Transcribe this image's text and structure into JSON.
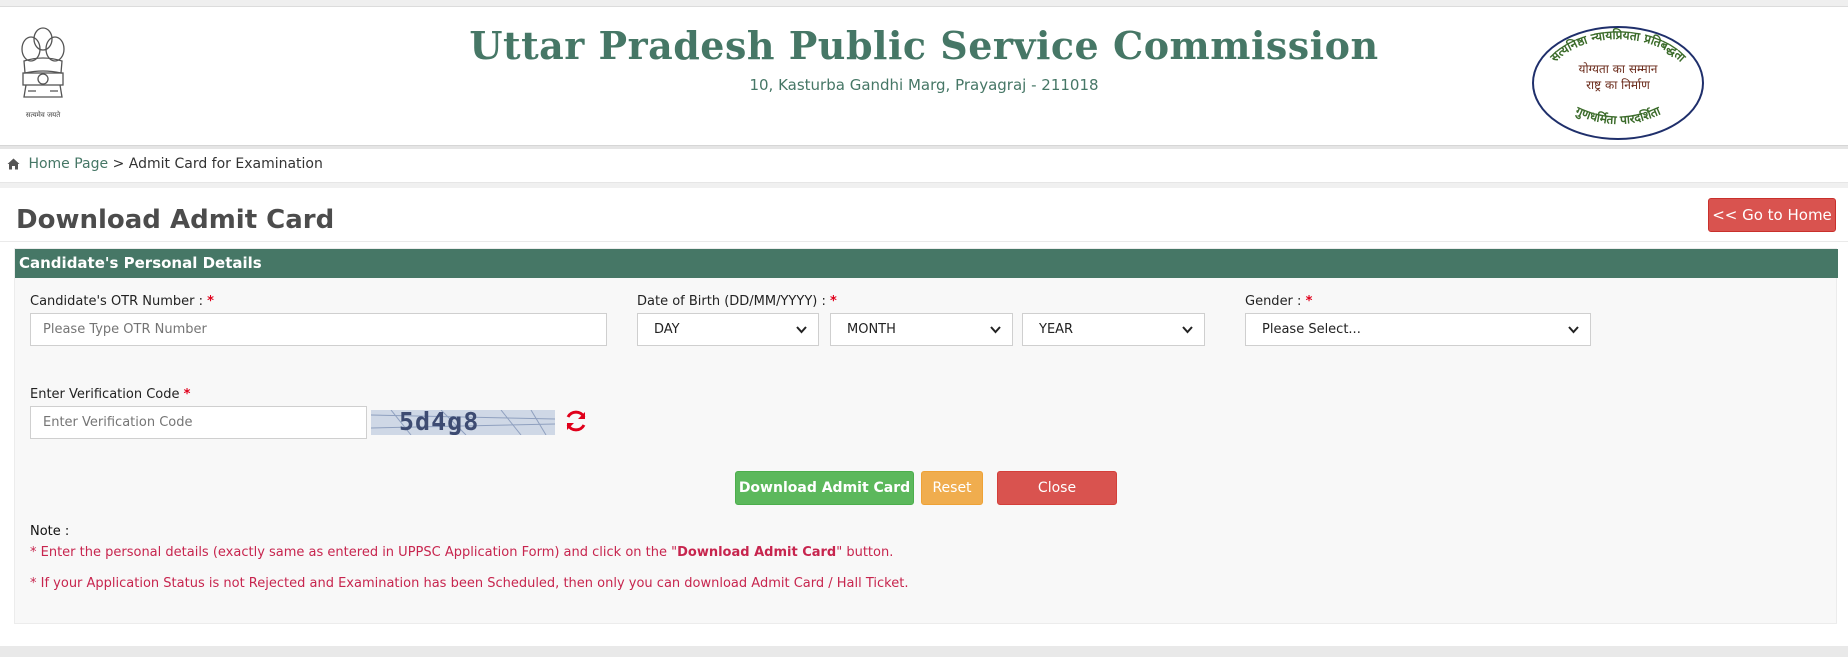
{
  "header": {
    "title": "Uttar Pradesh Public Service Commission",
    "address": "10, Kasturba Gandhi Marg, Prayagraj - 211018",
    "emblem_caption": "सत्यमेव जयते",
    "seal_text_top": "सत्यनिष्ठा न्यायप्रियता प्रतिबद्धता",
    "seal_line1": "योग्यता का सम्मान",
    "seal_line2": "राष्ट्र का निर्माण",
    "seal_text_bottom": "गुणधर्मिता पारदर्शिता"
  },
  "breadcrumb": {
    "home": "Home Page",
    "separator": ">",
    "current": "Admit Card for Examination"
  },
  "page": {
    "heading": "Download Admit Card",
    "go_home": "<< Go to Home"
  },
  "panel": {
    "title": "Candidate's Personal Details"
  },
  "form": {
    "otr_label": "Candidate's OTR Number :",
    "otr_placeholder": "Please Type OTR Number",
    "dob_label": "Date of Birth (DD/MM/YYYY) :",
    "day": "DAY",
    "month": "MONTH",
    "year": "YEAR",
    "gender_label": "Gender :",
    "gender_value": "Please Select...",
    "code_label": "Enter Verification Code",
    "code_placeholder": "Enter Verification Code",
    "captcha_text": "5d4g8",
    "required_mark": "*"
  },
  "buttons": {
    "download": "Download Admit Card",
    "reset": "Reset",
    "close": "Close"
  },
  "notes": {
    "label": "Note :",
    "line1_pre": "* Enter the personal details (exactly same as entered in UPPSC Application Form) and click on the \"",
    "line1_bold": "Download Admit Card",
    "line1_post": "\" button.",
    "line2": "* If your Application Status is not Rejected and Examination has been Scheduled, then only you can download Admit Card / Hall Ticket."
  },
  "colors": {
    "brand_green": "#467766",
    "danger": "#d9534f",
    "success": "#5cb85c",
    "warning": "#f0ad4e",
    "note_red": "#c7254e"
  }
}
